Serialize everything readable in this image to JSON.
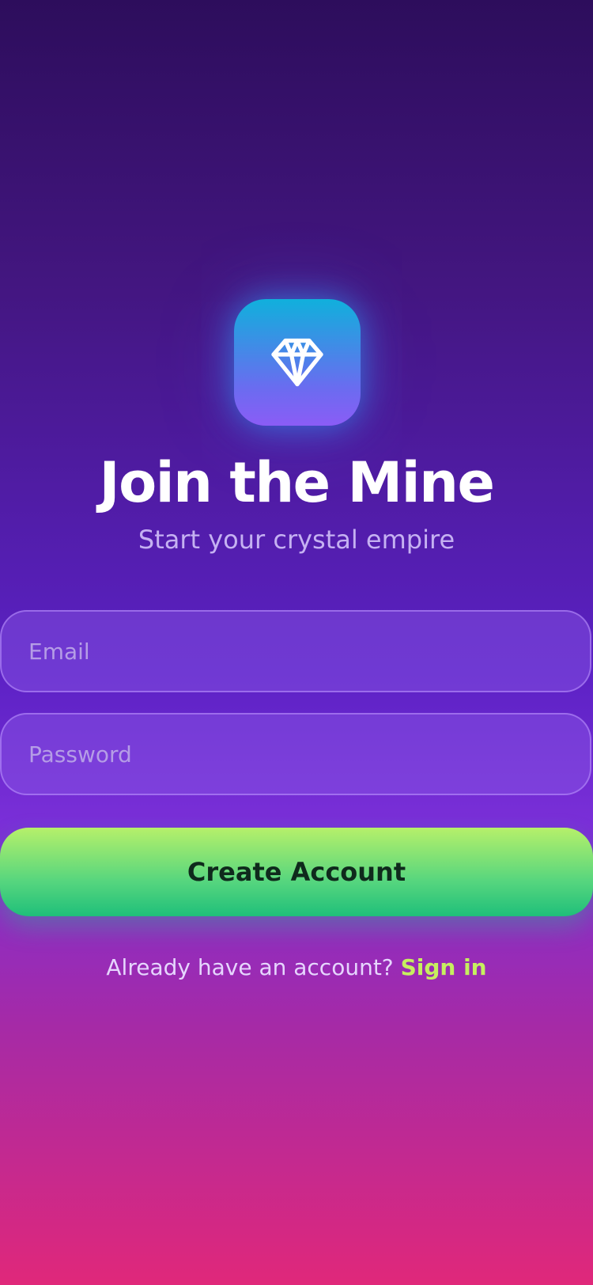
{
  "app": {
    "title": "Join the Mine",
    "subtitle": "Start your crystal empire",
    "logo_icon": "diamond-icon"
  },
  "form": {
    "email": {
      "value": "",
      "placeholder": "Email"
    },
    "password": {
      "value": "",
      "placeholder": "Password"
    },
    "submit_label": "Create Account"
  },
  "footer": {
    "prompt": "Already have an account?",
    "link_label": "Sign in"
  },
  "colors": {
    "background_top": "#2d0d5c",
    "background_mid": "#5b21c4",
    "background_bottom": "#e0287a",
    "logo_gradient_top": "#10b0dc",
    "logo_gradient_bottom": "#8b5cf6",
    "cta_gradient_top": "#b6f06a",
    "cta_gradient_bottom": "#1fbf7a",
    "link_accent": "#c6ef5f"
  }
}
